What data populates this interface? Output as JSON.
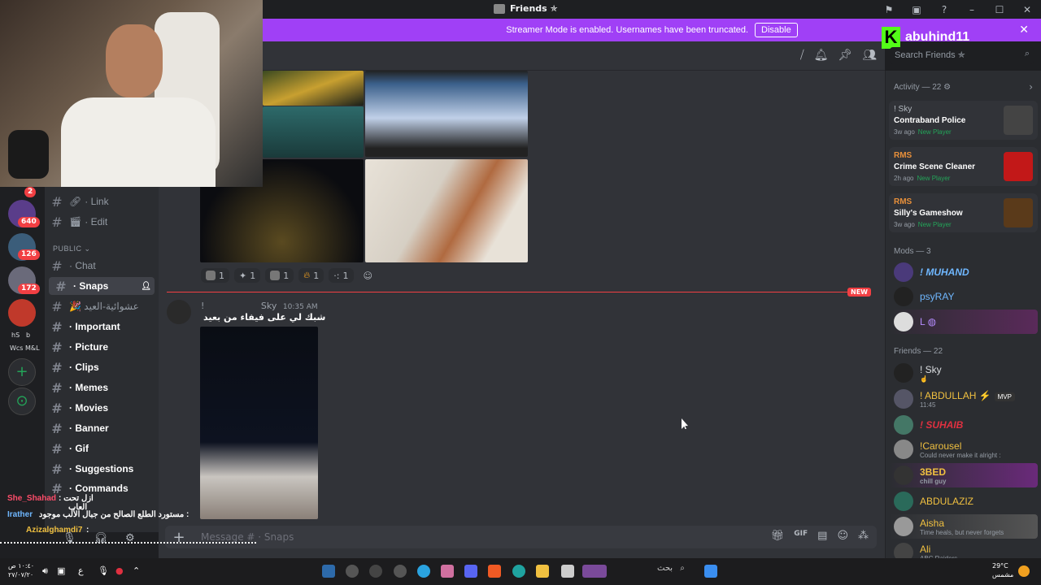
{
  "window": {
    "title": "Friends ✯"
  },
  "banner": {
    "text": "Streamer Mode is enabled. Usernames have been truncated.",
    "disable_label": "Disable"
  },
  "kick": {
    "logo": "K",
    "username": "abuhind11"
  },
  "search": {
    "placeholder": "Search Friends ✯"
  },
  "server_badges": {
    "top": "2",
    "b1": "640",
    "b2": "126",
    "b3": "172"
  },
  "server_labels": {
    "hs": "hS",
    "b": "b",
    "wcs": "Wcs M&L"
  },
  "channels": {
    "link": "· Link",
    "edit": "· Edit",
    "public_category": "PUBLIC ⌄",
    "chat": "· Chat",
    "snaps": "· Snaps",
    "arabic": "🎉 عشوائية-العيد",
    "important": "· Important",
    "picture": "· Picture",
    "clips": "· Clips",
    "memes": "· Memes",
    "movies": "· Movies",
    "banner": "· Banner",
    "gif": "· Gif",
    "suggestions": "· Suggestions",
    "commands": "· Commands"
  },
  "reactions": [
    {
      "icon": "photo-reaction-icon",
      "count": "1"
    },
    {
      "icon": "star-reaction-icon",
      "count": "1"
    },
    {
      "icon": "photo-reaction-icon",
      "count": "1"
    },
    {
      "icon": "fire-reaction-icon",
      "count": "1"
    },
    {
      "icon": "dots-reaction-icon",
      "count": "1"
    }
  ],
  "new_tag": "NEW",
  "message": {
    "prefix": "!",
    "author": "Sky",
    "time": "10:35 AM",
    "text": "شبك لي على فيفاء من بعيد"
  },
  "composer": {
    "placeholder": "Message # · Snaps"
  },
  "activity": {
    "header": "Activity — 22 ⚙",
    "items": [
      {
        "user": "! Sky",
        "game": "Contraband Police",
        "ago": "3w ago",
        "tag": "New Player"
      },
      {
        "user": "RMS",
        "game": "Crime Scene Cleaner",
        "ago": "2h ago",
        "tag": "New Player"
      },
      {
        "user": "RMS",
        "game": "Silly's Gameshow",
        "ago": "3w ago",
        "tag": "New Player"
      }
    ]
  },
  "mods": {
    "header": "Mods — 3",
    "items": [
      {
        "name": "! MUHAND",
        "color": "#6fb7ff"
      },
      {
        "name": "psyRAY",
        "color": "#6fb7ff"
      },
      {
        "name": "L ◍",
        "color": "#b68cff"
      }
    ]
  },
  "friends": {
    "header": "Friends — 22",
    "items": [
      {
        "name": "! Sky",
        "sub": "☝",
        "color": "#dbdee1"
      },
      {
        "name": "! ABDULLAH ⚡",
        "sub": "11:45",
        "color": "#f0c040",
        "mvp": "MVP"
      },
      {
        "name": "! SUHAIB",
        "sub": "",
        "color": "#e03040"
      },
      {
        "name": "!Carousel",
        "sub": "Could never make it alright :",
        "color": "#f0c040"
      },
      {
        "name": "3BED",
        "sub": "chill guy",
        "color": "#f0c040"
      },
      {
        "name": "ABDULAZIZ",
        "sub": "",
        "color": "#f0c040"
      },
      {
        "name": "Aisha",
        "sub": "Time heals, but never forgets",
        "color": "#f0c040"
      },
      {
        "name": "Ali",
        "sub": "ABC Raiders",
        "color": "#f0c040"
      }
    ]
  },
  "chat_overlay": {
    "line1_user": "She_Shahad",
    "line1_text": ": ازل تحت",
    "line1b_text": "العاب",
    "line2_user": "Irather",
    "line2_text": "مستورد الطلع الصالح من جبال الألب موجود :",
    "line3_user": "Azizalghamdi7",
    "line3_text": ":"
  },
  "taskbar": {
    "clock_time": "١٠:٤٠ ص",
    "clock_date": "٢٧/٠٧/٢٠",
    "lang": "ع",
    "search": "بحث",
    "temp": "29°C",
    "weather": "مشمس"
  }
}
